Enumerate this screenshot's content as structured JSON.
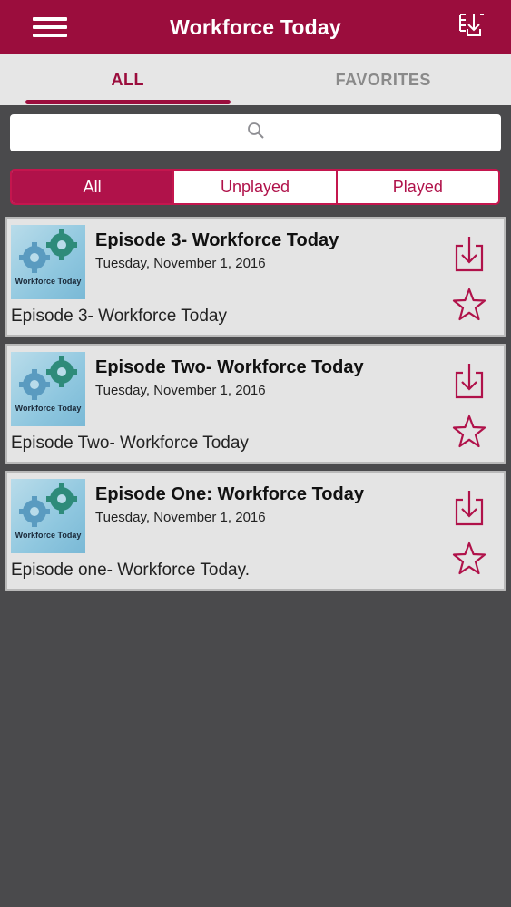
{
  "header": {
    "title": "Workforce Today",
    "menu_icon": "hamburger-menu-icon",
    "download_all_icon": "download-list-icon"
  },
  "tabs": [
    {
      "label": "ALL",
      "active": true
    },
    {
      "label": "FAVORITES",
      "active": false
    }
  ],
  "search": {
    "placeholder": "",
    "icon": "search-icon"
  },
  "filter": {
    "options": [
      "All",
      "Unplayed",
      "Played"
    ],
    "selected": "All"
  },
  "episodes": [
    {
      "title": "Episode 3- Workforce Today",
      "date": "Tuesday, November 1, 2016",
      "description": "Episode 3- Workforce Today",
      "thumbnail_title": "Workforce Today"
    },
    {
      "title": "Episode Two- Workforce Today",
      "date": "Tuesday, November 1, 2016",
      "description": "Episode Two- Workforce Today",
      "thumbnail_title": "Workforce Today"
    },
    {
      "title": "Episode One: Workforce Today",
      "date": "Tuesday, November 1, 2016",
      "description": "Episode one- Workforce Today.",
      "thumbnail_title": "Workforce Today"
    }
  ],
  "colors": {
    "brand": "#9b0d3d",
    "accent": "#c4164e",
    "background": "#4a4a4c",
    "card": "#e4e4e4"
  }
}
